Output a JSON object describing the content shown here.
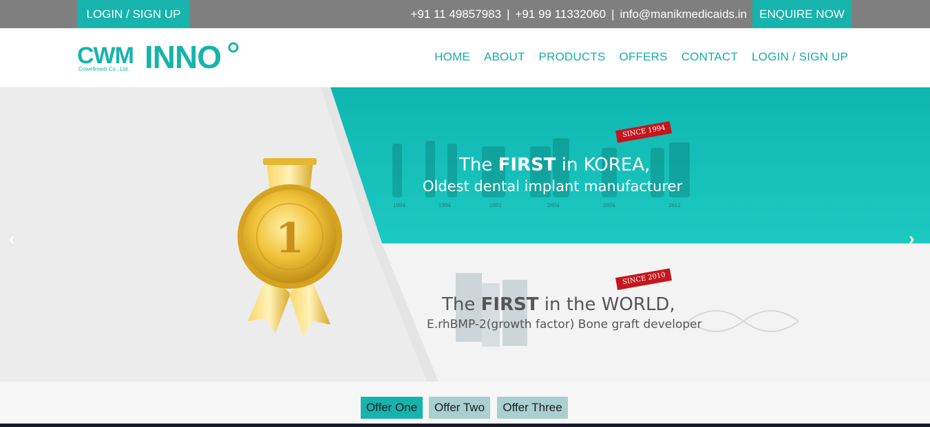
{
  "topbar": {
    "login_label": "LOGIN / SIGN UP",
    "phone1": "+91 11 49857983",
    "phone2": "+91 99 11332060",
    "email": "info@manikmedicaids.in",
    "separator": "|",
    "enquire_label": "ENQUIRE NOW"
  },
  "logo": {
    "brand_left": "CWM",
    "brand_right": "INNO",
    "company": "Cowellmedi Co., Ltd."
  },
  "nav": {
    "items": [
      "HOME",
      "ABOUT",
      "PRODUCTS",
      "OFFERS",
      "CONTACT",
      "LOGIN / SIGN UP"
    ]
  },
  "slider": {
    "prev_arrow": "‹",
    "next_arrow": "›",
    "medal_number": "1",
    "panel1": {
      "ribbon": "SINCE 1994",
      "line1_pre": "The ",
      "line1_bold": "FIRST",
      "line1_post": " in KOREA,",
      "line2": "Oldest dental implant manufacturer",
      "years": [
        "1994",
        "1994",
        "2002",
        "2004",
        "2004",
        "2012"
      ]
    },
    "panel2": {
      "ribbon": "SINCE 2010",
      "line1_pre": "The ",
      "line1_bold": "FIRST",
      "line1_post": " in the WORLD,",
      "line2": "E.rhBMP-2(growth factor) Bone graft developer"
    }
  },
  "offers": {
    "tabs": [
      "Offer One",
      "Offer Two",
      "Offer Three"
    ]
  },
  "colors": {
    "accent": "#17b3ad",
    "topbar": "#7f7f7f",
    "ribbon_red": "#c4161c",
    "gold": "#e8b92c"
  }
}
